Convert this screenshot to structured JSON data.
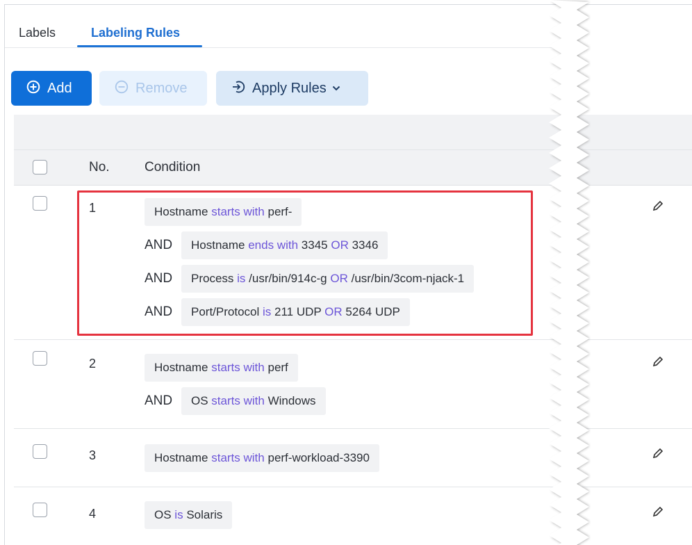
{
  "tabs": [
    {
      "label": "Labels",
      "active": false
    },
    {
      "label": "Labeling Rules",
      "active": true
    }
  ],
  "toolbar": {
    "add_label": "Add",
    "add_icon": "plus-circle-icon",
    "remove_label": "Remove",
    "remove_icon": "minus-circle-icon",
    "apply_label": "Apply Rules",
    "apply_icon": "apply-arrow-icon",
    "apply_dropdown_icon": "chevron-down-icon"
  },
  "table": {
    "columns": [
      "No.",
      "Condition"
    ],
    "and_label": "AND",
    "rows": [
      {
        "no": "1",
        "conditions": [
          {
            "field": "Hostname",
            "op": "starts with",
            "values": [
              "perf-"
            ]
          },
          {
            "field": "Hostname",
            "op": "ends with",
            "values": [
              "3345",
              "3346"
            ]
          },
          {
            "field": "Process",
            "op": "is",
            "values": [
              "/usr/bin/914c-g",
              "/usr/bin/3com-njack-1"
            ]
          },
          {
            "field": "Port/Protocol",
            "op": "is",
            "values": [
              "211 UDP",
              "5264 UDP"
            ]
          }
        ]
      },
      {
        "no": "2",
        "conditions": [
          {
            "field": "Hostname",
            "op": "starts with",
            "values": [
              "perf"
            ]
          },
          {
            "field": "OS",
            "op": "starts with",
            "values": [
              "Windows"
            ]
          }
        ]
      },
      {
        "no": "3",
        "conditions": [
          {
            "field": "Hostname",
            "op": "starts with",
            "values": [
              "perf-workload-3390"
            ]
          }
        ]
      },
      {
        "no": "4",
        "conditions": [
          {
            "field": "OS",
            "op": "is",
            "values": [
              "Solaris"
            ]
          }
        ]
      }
    ],
    "or_label": "OR",
    "edit_icon": "pencil-icon"
  },
  "colors": {
    "primary": "#0f6fd9",
    "keyword": "#6c55d8",
    "highlight": "#e5333f"
  }
}
